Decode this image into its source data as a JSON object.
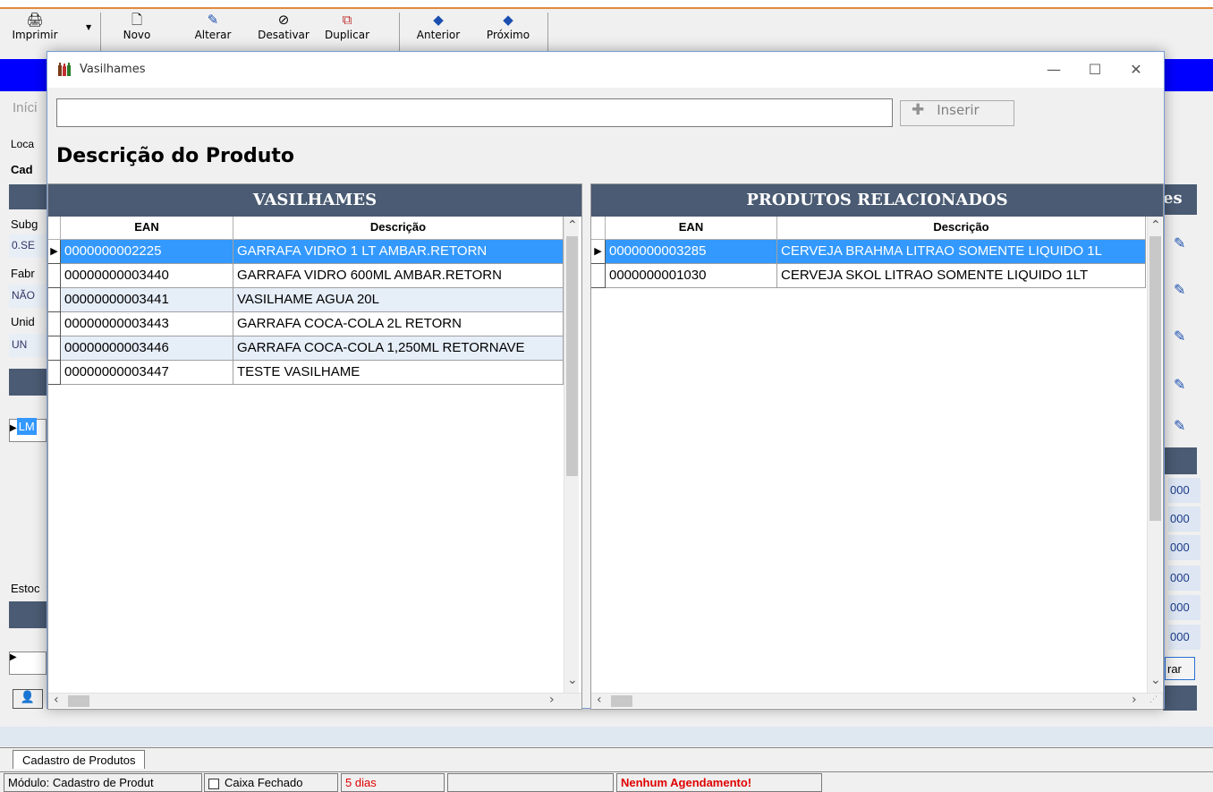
{
  "toolbar": {
    "print": "Imprimir",
    "new": "Novo",
    "edit": "Alterar",
    "deactivate": "Desativar",
    "duplicate": "Duplicar",
    "previous": "Anterior",
    "next": "Próximo"
  },
  "background": {
    "inicio": "Iníci",
    "local": "Loca",
    "cad": "Cad",
    "subg": "Subg",
    "subg_value": "0.SE",
    "fabr": "Fabr",
    "fabr_value": "NÃO",
    "unid": "Unid",
    "unid_value": "UN",
    "row_value": "LM",
    "estoc": "Estoc",
    "right_suffix": "es",
    "right_numbers": [
      "000",
      "000",
      "000",
      "000",
      "000",
      "000"
    ],
    "right_btn": "rar"
  },
  "dialog": {
    "title": "Vasilhames",
    "search_value": "",
    "insert_label": "Inserir",
    "heading": "Descrição do Produto",
    "left_panel": {
      "title": "VASILHAMES",
      "columns": [
        "EAN",
        "Descrição"
      ],
      "rows": [
        {
          "ean": "0000000002225",
          "desc": "GARRAFA VIDRO 1 LT AMBAR.RETORN"
        },
        {
          "ean": "00000000003440",
          "desc": "GARRAFA VIDRO 600ML AMBAR.RETORN"
        },
        {
          "ean": "00000000003441",
          "desc": "VASILHAME AGUA 20L"
        },
        {
          "ean": "00000000003443",
          "desc": "GARRAFA COCA-COLA 2L RETORN"
        },
        {
          "ean": "00000000003446",
          "desc": "GARRAFA COCA-COLA 1,250ML RETORNAVE"
        },
        {
          "ean": "00000000003447",
          "desc": "TESTE VASILHAME"
        }
      ]
    },
    "right_panel": {
      "title": "PRODUTOS RELACIONADOS",
      "columns": [
        "EAN",
        "Descrição"
      ],
      "rows": [
        {
          "ean": "0000000003285",
          "desc": "CERVEJA BRAHMA LITRAO SOMENTE LIQUIDO 1L"
        },
        {
          "ean": "0000000001030",
          "desc": "CERVEJA SKOL LITRAO SOMENTE LIQUIDO 1LT"
        }
      ]
    }
  },
  "tabs": {
    "active": "Cadastro de Produtos"
  },
  "statusbar": {
    "module": "Módulo: Cadastro de Produt",
    "caixa": "Caixa Fechado",
    "days": "5 dias",
    "agendamento": "Nenhum Agendamento!"
  },
  "colors": {
    "navy_header": "#4a5b73",
    "selection": "#3399ff",
    "alt_row": "#e6eef8",
    "app_blue": "#0000ff",
    "status_red": "#ff0000"
  }
}
